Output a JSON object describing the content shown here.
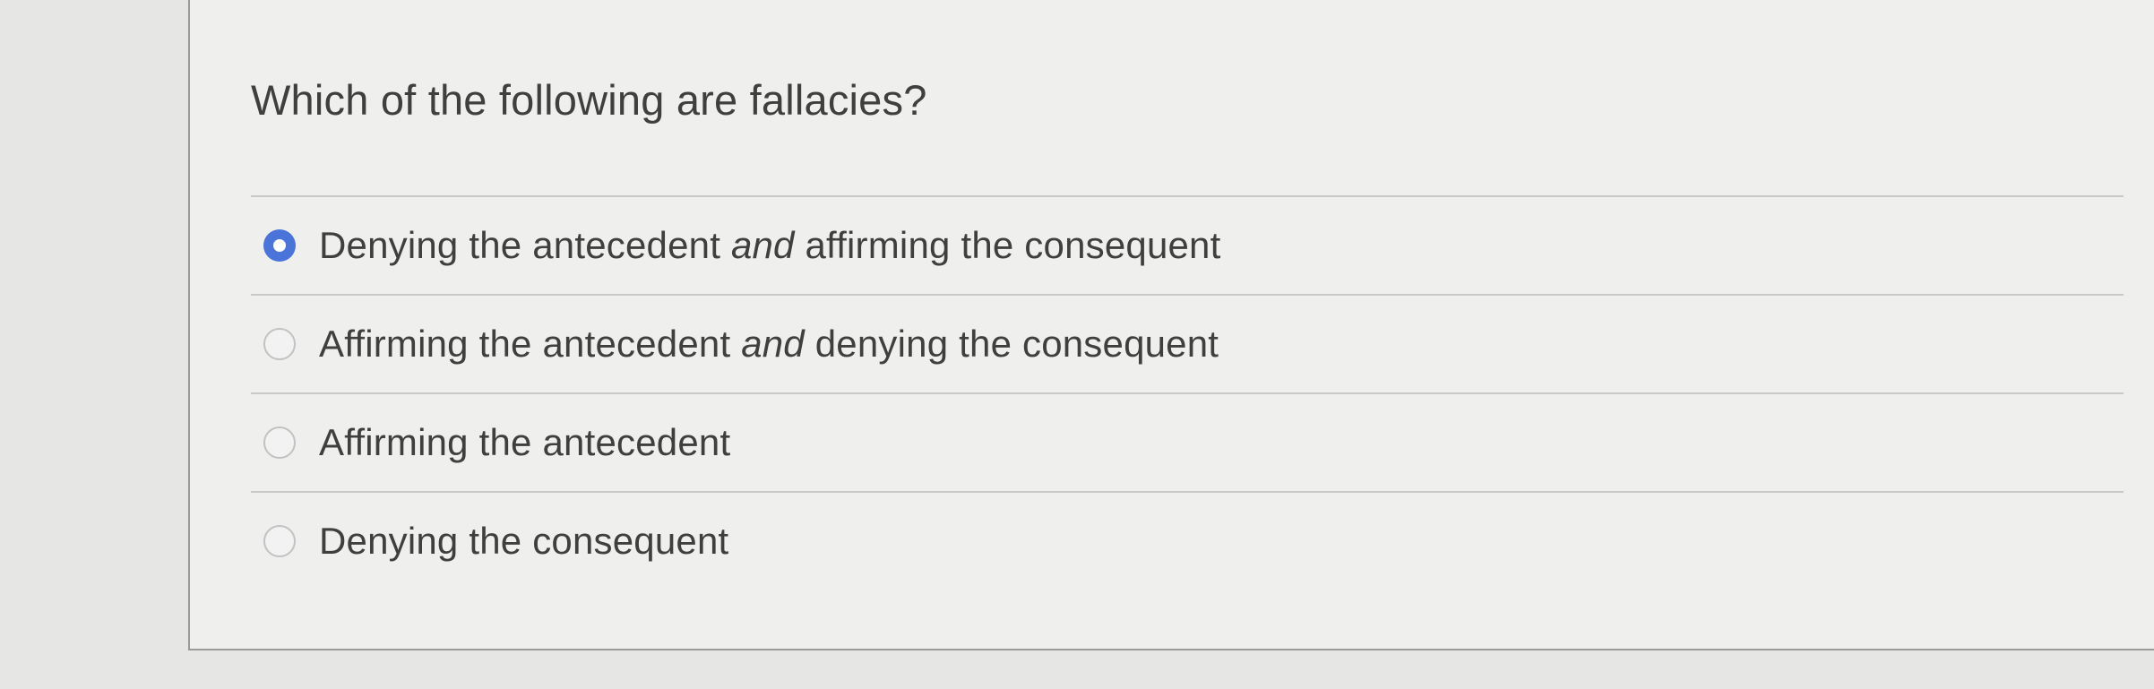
{
  "question": {
    "text": "Which of the following are fallacies?"
  },
  "options": [
    {
      "label_before": "Denying the antecedent ",
      "label_emphasis": "and",
      "label_after": " affirming the consequent",
      "selected": true
    },
    {
      "label_before": "Affirming the antecedent ",
      "label_emphasis": "and",
      "label_after": " denying the consequent",
      "selected": false
    },
    {
      "label_before": "Affirming the antecedent",
      "selected": false
    },
    {
      "label_before": "Denying the consequent",
      "selected": false
    }
  ],
  "colors": {
    "accent": "#4a74d9",
    "text": "#3f3f3f",
    "background": "#efefed"
  }
}
